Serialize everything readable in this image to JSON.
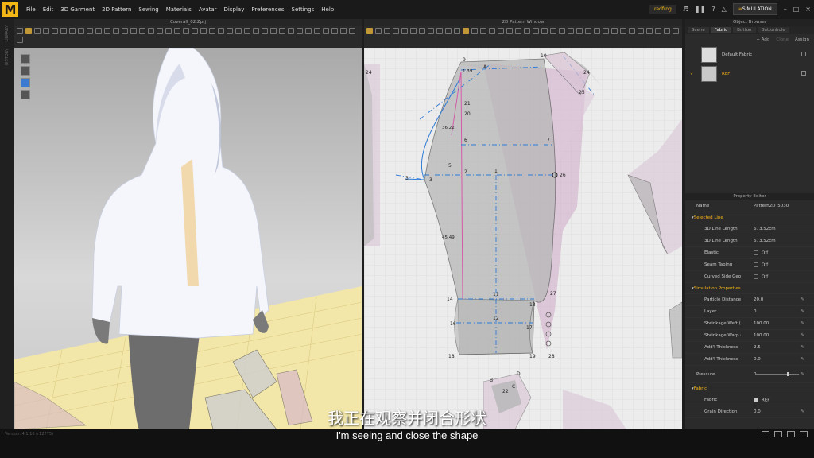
{
  "app": {
    "logo": "M"
  },
  "menu": [
    "File",
    "Edit",
    "3D Garment",
    "2D Pattern",
    "Sewing",
    "Materials",
    "Avatar",
    "Display",
    "Preferences",
    "Settings",
    "Help"
  ],
  "user": {
    "name": "redfrog"
  },
  "mode": "SIMULATION",
  "left_strip": {
    "labels": [
      "LIBRARY",
      "HISTORY"
    ]
  },
  "window3d": {
    "title": "Coverall_02.Zprj"
  },
  "window2d": {
    "title": "2D Pattern Window"
  },
  "pattern_labels": {
    "points": [
      "9",
      "A",
      "10",
      "24",
      "25",
      "21",
      "20",
      "6",
      "7",
      "5",
      "2",
      "1",
      "26",
      "3",
      "14",
      "11",
      "13",
      "27",
      "12",
      "17",
      "16",
      "18",
      "19",
      "28",
      "B",
      "D",
      "C",
      "22",
      "23",
      "4",
      "8"
    ],
    "measurements": [
      "1.39",
      "36.22",
      "45.49"
    ],
    "colors": {
      "blue": "#2e7bd6",
      "pink": "#d45aa8",
      "shade_grey": "#b7b7b7"
    }
  },
  "object_browser": {
    "title": "Object Browser",
    "tabs": [
      "Scene",
      "Fabric",
      "Button",
      "Buttonhole"
    ],
    "active_tab": "Fabric",
    "buttons": {
      "add": "+ Add",
      "clone": "Clone",
      "assign": "Assign"
    },
    "fabrics": [
      {
        "name": "Default Fabric",
        "selected": false
      },
      {
        "name": "REF",
        "selected": true
      }
    ]
  },
  "property_editor": {
    "title": "Property Editor",
    "name_label": "Name",
    "name_value": "Pattern2D_5030",
    "sections": [
      {
        "title": "Selected Line",
        "rows": [
          {
            "key": "3D Line Length",
            "value": "673.52cm"
          },
          {
            "key": "3D Line Length",
            "value": "673.52cm"
          },
          {
            "key": "Elastic",
            "value": "Off"
          },
          {
            "key": "Seam Taping",
            "value": "Off"
          },
          {
            "key": "Curved Side Geome",
            "value": "Off"
          }
        ]
      },
      {
        "title": "Simulation Properties",
        "rows": [
          {
            "key": "Particle Distance (n",
            "value": "20.0"
          },
          {
            "key": "Layer",
            "value": "0"
          },
          {
            "key": "Shrinkage Weft (%",
            "value": "100.00"
          },
          {
            "key": "Shrinkage Warp (%",
            "value": "100.00"
          },
          {
            "key": "Add'l Thickness - Collisio",
            "value": "2.5"
          },
          {
            "key": "Add'l Thickness - Render",
            "value": "0.0"
          },
          {
            "key": "Pressure",
            "value": "0"
          }
        ]
      },
      {
        "title": "Fabric",
        "rows": [
          {
            "key": "Fabric",
            "value": "REF"
          },
          {
            "key": "Grain Direction",
            "value": "0.0"
          }
        ]
      }
    ]
  },
  "status": {
    "version": "Version: 4.1.16 (r12775)"
  },
  "subtitles": {
    "chinese": "我正在观察并闭合形状",
    "english": "I'm seeing and close the shape"
  }
}
